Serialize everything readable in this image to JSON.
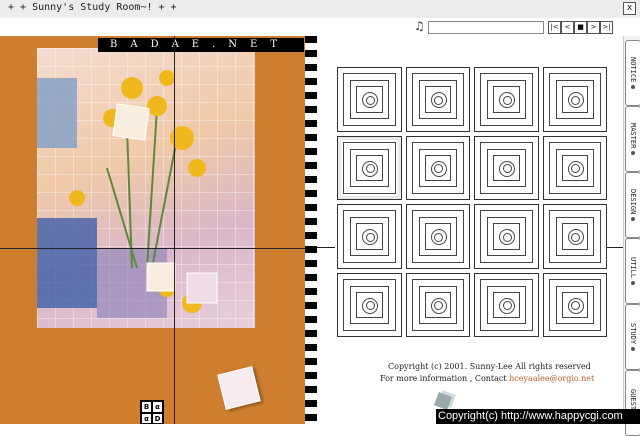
{
  "window": {
    "title": "+ + Sunny's Study Room~! + +",
    "close_label": "x"
  },
  "player": {
    "music_icon": "music-note-icon",
    "controls": [
      "|<",
      "<",
      "■",
      ">",
      ">|"
    ]
  },
  "left": {
    "logo_text": "BADAE.NET",
    "bcd": [
      "B",
      "α",
      "α",
      "D"
    ]
  },
  "tabs": [
    {
      "label": "NOTICE"
    },
    {
      "label": "MASTER"
    },
    {
      "label": "DESIGN"
    },
    {
      "label": "UTILL"
    },
    {
      "label": "STUDY"
    },
    {
      "label": "GUEST"
    }
  ],
  "footer": {
    "copyright": "Copyright (c) 2001. Sunny-Lee All rights reserved",
    "info_prefix": "For more information , Contact",
    "email": "hceyaalee@orgio.net",
    "overlay": "Copyright(c) http://www.happycgi.com"
  }
}
